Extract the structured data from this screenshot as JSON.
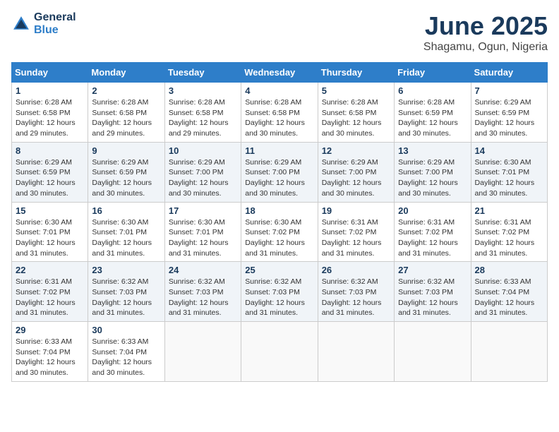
{
  "header": {
    "logo_line1": "General",
    "logo_line2": "Blue",
    "month": "June 2025",
    "location": "Shagamu, Ogun, Nigeria"
  },
  "weekdays": [
    "Sunday",
    "Monday",
    "Tuesday",
    "Wednesday",
    "Thursday",
    "Friday",
    "Saturday"
  ],
  "weeks": [
    [
      {
        "day": "1",
        "info": "Sunrise: 6:28 AM\nSunset: 6:58 PM\nDaylight: 12 hours\nand 29 minutes."
      },
      {
        "day": "2",
        "info": "Sunrise: 6:28 AM\nSunset: 6:58 PM\nDaylight: 12 hours\nand 29 minutes."
      },
      {
        "day": "3",
        "info": "Sunrise: 6:28 AM\nSunset: 6:58 PM\nDaylight: 12 hours\nand 29 minutes."
      },
      {
        "day": "4",
        "info": "Sunrise: 6:28 AM\nSunset: 6:58 PM\nDaylight: 12 hours\nand 30 minutes."
      },
      {
        "day": "5",
        "info": "Sunrise: 6:28 AM\nSunset: 6:58 PM\nDaylight: 12 hours\nand 30 minutes."
      },
      {
        "day": "6",
        "info": "Sunrise: 6:28 AM\nSunset: 6:59 PM\nDaylight: 12 hours\nand 30 minutes."
      },
      {
        "day": "7",
        "info": "Sunrise: 6:29 AM\nSunset: 6:59 PM\nDaylight: 12 hours\nand 30 minutes."
      }
    ],
    [
      {
        "day": "8",
        "info": "Sunrise: 6:29 AM\nSunset: 6:59 PM\nDaylight: 12 hours\nand 30 minutes."
      },
      {
        "day": "9",
        "info": "Sunrise: 6:29 AM\nSunset: 6:59 PM\nDaylight: 12 hours\nand 30 minutes."
      },
      {
        "day": "10",
        "info": "Sunrise: 6:29 AM\nSunset: 7:00 PM\nDaylight: 12 hours\nand 30 minutes."
      },
      {
        "day": "11",
        "info": "Sunrise: 6:29 AM\nSunset: 7:00 PM\nDaylight: 12 hours\nand 30 minutes."
      },
      {
        "day": "12",
        "info": "Sunrise: 6:29 AM\nSunset: 7:00 PM\nDaylight: 12 hours\nand 30 minutes."
      },
      {
        "day": "13",
        "info": "Sunrise: 6:29 AM\nSunset: 7:00 PM\nDaylight: 12 hours\nand 30 minutes."
      },
      {
        "day": "14",
        "info": "Sunrise: 6:30 AM\nSunset: 7:01 PM\nDaylight: 12 hours\nand 30 minutes."
      }
    ],
    [
      {
        "day": "15",
        "info": "Sunrise: 6:30 AM\nSunset: 7:01 PM\nDaylight: 12 hours\nand 31 minutes."
      },
      {
        "day": "16",
        "info": "Sunrise: 6:30 AM\nSunset: 7:01 PM\nDaylight: 12 hours\nand 31 minutes."
      },
      {
        "day": "17",
        "info": "Sunrise: 6:30 AM\nSunset: 7:01 PM\nDaylight: 12 hours\nand 31 minutes."
      },
      {
        "day": "18",
        "info": "Sunrise: 6:30 AM\nSunset: 7:02 PM\nDaylight: 12 hours\nand 31 minutes."
      },
      {
        "day": "19",
        "info": "Sunrise: 6:31 AM\nSunset: 7:02 PM\nDaylight: 12 hours\nand 31 minutes."
      },
      {
        "day": "20",
        "info": "Sunrise: 6:31 AM\nSunset: 7:02 PM\nDaylight: 12 hours\nand 31 minutes."
      },
      {
        "day": "21",
        "info": "Sunrise: 6:31 AM\nSunset: 7:02 PM\nDaylight: 12 hours\nand 31 minutes."
      }
    ],
    [
      {
        "day": "22",
        "info": "Sunrise: 6:31 AM\nSunset: 7:02 PM\nDaylight: 12 hours\nand 31 minutes."
      },
      {
        "day": "23",
        "info": "Sunrise: 6:32 AM\nSunset: 7:03 PM\nDaylight: 12 hours\nand 31 minutes."
      },
      {
        "day": "24",
        "info": "Sunrise: 6:32 AM\nSunset: 7:03 PM\nDaylight: 12 hours\nand 31 minutes."
      },
      {
        "day": "25",
        "info": "Sunrise: 6:32 AM\nSunset: 7:03 PM\nDaylight: 12 hours\nand 31 minutes."
      },
      {
        "day": "26",
        "info": "Sunrise: 6:32 AM\nSunset: 7:03 PM\nDaylight: 12 hours\nand 31 minutes."
      },
      {
        "day": "27",
        "info": "Sunrise: 6:32 AM\nSunset: 7:03 PM\nDaylight: 12 hours\nand 31 minutes."
      },
      {
        "day": "28",
        "info": "Sunrise: 6:33 AM\nSunset: 7:04 PM\nDaylight: 12 hours\nand 31 minutes."
      }
    ],
    [
      {
        "day": "29",
        "info": "Sunrise: 6:33 AM\nSunset: 7:04 PM\nDaylight: 12 hours\nand 30 minutes."
      },
      {
        "day": "30",
        "info": "Sunrise: 6:33 AM\nSunset: 7:04 PM\nDaylight: 12 hours\nand 30 minutes."
      },
      {
        "day": "",
        "info": ""
      },
      {
        "day": "",
        "info": ""
      },
      {
        "day": "",
        "info": ""
      },
      {
        "day": "",
        "info": ""
      },
      {
        "day": "",
        "info": ""
      }
    ]
  ]
}
